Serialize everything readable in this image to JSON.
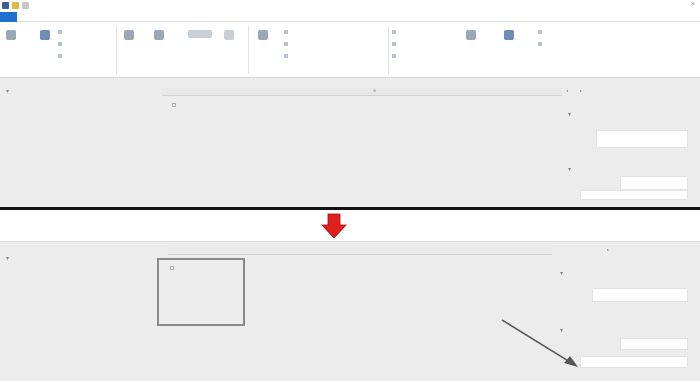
{
  "window": {
    "title": "",
    "close_glyph": "×",
    "icons": [
      "app-icon",
      "folder-icon",
      "save-icon"
    ]
  },
  "tabs": {
    "file_label": "",
    "items": [
      "",
      "",
      "",
      ""
    ]
  },
  "ribbon": {
    "buttons": [
      "",
      "",
      "",
      "",
      "",
      "",
      "",
      "",
      "",
      ""
    ],
    "groups": [
      "",
      "",
      "",
      "",
      "",
      ""
    ]
  },
  "form_top": {
    "section_label": "",
    "subgrid_header": "",
    "section1_title": "",
    "section1_field_label": "",
    "section2_title": "",
    "section2_field_label": "",
    "section2_field_label2": ""
  },
  "form_bottom": {
    "section_label": "",
    "subgrid_header": "",
    "section1_title": "",
    "section1_field_label": "",
    "section2_title": "",
    "section2_field_label": "",
    "section2_field_label2": ""
  },
  "colors": {
    "file_tab": "#1e6fd0",
    "arrow_red": "#e0201c",
    "background": "#ececec"
  }
}
